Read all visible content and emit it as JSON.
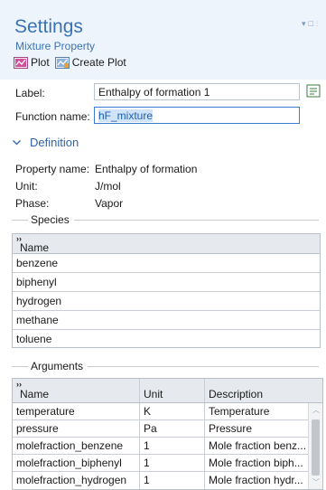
{
  "header": {
    "title": "Settings",
    "subtitle": "Mixture Property",
    "toolbar": {
      "plot_label": "Plot",
      "create_plot_label": "Create Plot"
    }
  },
  "form": {
    "label_caption": "Label:",
    "label_value": "Enthalpy of formation 1",
    "function_name_caption": "Function name:",
    "function_name_value": "hF_mixture"
  },
  "definition": {
    "section_title": "Definition",
    "property_name_caption": "Property name:",
    "property_name_value": "Enthalpy of formation",
    "unit_caption": "Unit:",
    "unit_value": "J/mol",
    "phase_caption": "Phase:",
    "phase_value": "Vapor"
  },
  "species": {
    "group_title": "Species",
    "header_marker": "››",
    "column_name": "Name",
    "rows": [
      "benzene",
      "biphenyl",
      "hydrogen",
      "methane",
      "toluene"
    ]
  },
  "arguments": {
    "group_title": "Arguments",
    "header_marker": "››",
    "columns": [
      "Name",
      "Unit",
      "Description"
    ],
    "rows": [
      [
        "temperature",
        "K",
        "Temperature"
      ],
      [
        "pressure",
        "Pa",
        "Pressure"
      ],
      [
        "molefraction_benzene",
        "1",
        "Mole fraction benz..."
      ],
      [
        "molefraction_biphenyl",
        "1",
        "Mole fraction biph..."
      ],
      [
        "molefraction_hydrogen",
        "1",
        "Mole fraction hydr..."
      ]
    ]
  },
  "colors": {
    "accent": "#3a73b5",
    "header_bg": "#eef4fb",
    "selection": "#cfe3f9"
  },
  "icons": {
    "plot": "plot-icon",
    "create_plot": "create-plot-icon",
    "label_edit": "text-edit-icon",
    "section_toggle": "chevron-down-icon"
  }
}
